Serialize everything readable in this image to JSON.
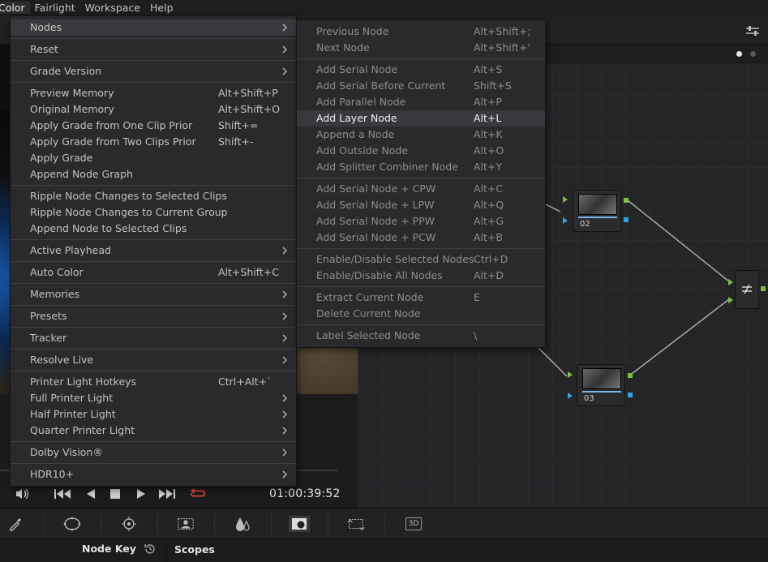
{
  "menubar": {
    "items": [
      "Color",
      "Fairlight",
      "Workspace",
      "Help"
    ],
    "active": "Color"
  },
  "color_menu": {
    "groups": [
      [
        {
          "label": "Nodes",
          "shortcut": "",
          "submenu": true,
          "highlighted": true
        }
      ],
      [
        {
          "label": "Reset",
          "shortcut": "",
          "submenu": true
        }
      ],
      [
        {
          "label": "Grade Version",
          "shortcut": "",
          "submenu": true
        }
      ],
      [
        {
          "label": "Preview Memory",
          "shortcut": "Alt+Shift+P",
          "submenu": false
        },
        {
          "label": "Original Memory",
          "shortcut": "Alt+Shift+O",
          "submenu": false
        },
        {
          "label": "Apply Grade from One Clip Prior",
          "shortcut": "Shift+=",
          "submenu": false
        },
        {
          "label": "Apply Grade from Two Clips Prior",
          "shortcut": "Shift+-",
          "submenu": false
        },
        {
          "label": "Apply Grade",
          "shortcut": "",
          "submenu": false
        },
        {
          "label": "Append Node Graph",
          "shortcut": "",
          "submenu": false
        }
      ],
      [
        {
          "label": "Ripple Node Changes to Selected Clips",
          "shortcut": "",
          "submenu": false
        },
        {
          "label": "Ripple Node Changes to Current Group",
          "shortcut": "",
          "submenu": false
        },
        {
          "label": "Append Node to Selected Clips",
          "shortcut": "",
          "submenu": false
        }
      ],
      [
        {
          "label": "Active Playhead",
          "shortcut": "",
          "submenu": true
        }
      ],
      [
        {
          "label": "Auto Color",
          "shortcut": "Alt+Shift+C",
          "submenu": false
        }
      ],
      [
        {
          "label": "Memories",
          "shortcut": "",
          "submenu": true
        }
      ],
      [
        {
          "label": "Presets",
          "shortcut": "",
          "submenu": true
        }
      ],
      [
        {
          "label": "Tracker",
          "shortcut": "",
          "submenu": true
        }
      ],
      [
        {
          "label": "Resolve Live",
          "shortcut": "",
          "submenu": true
        }
      ],
      [
        {
          "label": "Printer Light Hotkeys",
          "shortcut": "Ctrl+Alt+`",
          "submenu": false
        },
        {
          "label": "Full Printer Light",
          "shortcut": "",
          "submenu": true
        },
        {
          "label": "Half Printer Light",
          "shortcut": "",
          "submenu": true
        },
        {
          "label": "Quarter Printer Light",
          "shortcut": "",
          "submenu": true
        }
      ],
      [
        {
          "label": "Dolby Vision®",
          "shortcut": "",
          "submenu": true
        }
      ],
      [
        {
          "label": "HDR10+",
          "shortcut": "",
          "submenu": true
        }
      ]
    ]
  },
  "nodes_menu": {
    "groups": [
      [
        {
          "label": "Previous Node",
          "shortcut": "Alt+Shift+;",
          "dim": true
        },
        {
          "label": "Next Node",
          "shortcut": "Alt+Shift+'",
          "dim": true
        }
      ],
      [
        {
          "label": "Add Serial Node",
          "shortcut": "Alt+S",
          "dim": true
        },
        {
          "label": "Add Serial Before Current",
          "shortcut": "Shift+S",
          "dim": true
        },
        {
          "label": "Add Parallel Node",
          "shortcut": "Alt+P",
          "dim": true
        },
        {
          "label": "Add Layer Node",
          "shortcut": "Alt+L",
          "dim": false,
          "highlighted": true
        },
        {
          "label": "Append a Node",
          "shortcut": "Alt+K",
          "dim": true
        },
        {
          "label": "Add Outside Node",
          "shortcut": "Alt+O",
          "dim": true
        },
        {
          "label": "Add Splitter Combiner Node",
          "shortcut": "Alt+Y",
          "dim": true
        }
      ],
      [
        {
          "label": "Add Serial Node + CPW",
          "shortcut": "Alt+C",
          "dim": true
        },
        {
          "label": "Add Serial Node + LPW",
          "shortcut": "Alt+Q",
          "dim": true
        },
        {
          "label": "Add Serial Node + PPW",
          "shortcut": "Alt+G",
          "dim": true
        },
        {
          "label": "Add Serial Node + PCW",
          "shortcut": "Alt+B",
          "dim": true
        }
      ],
      [
        {
          "label": "Enable/Disable Selected Nodes",
          "shortcut": "Ctrl+D",
          "dim": true
        },
        {
          "label": "Enable/Disable All Nodes",
          "shortcut": "Alt+D",
          "dim": true
        }
      ],
      [
        {
          "label": "Extract Current Node",
          "shortcut": "E",
          "dim": true
        },
        {
          "label": "Delete Current Node",
          "shortcut": "",
          "dim": true
        }
      ],
      [
        {
          "label": "Label Selected Node",
          "shortcut": "\\",
          "dim": true
        }
      ]
    ]
  },
  "transport": {
    "timecode": "01:00:39:52",
    "buttons": [
      "volume-icon",
      "jump-to-start-icon",
      "play-reverse-icon",
      "stop-icon",
      "play-icon",
      "jump-to-end-icon",
      "loop-icon"
    ]
  },
  "node_graph": {
    "nodes": [
      {
        "label": "02"
      },
      {
        "label": "03"
      }
    ],
    "mixer_icon": "layer-mixer-icon"
  },
  "palette_bar": {
    "icons": [
      "eyedropper-icon",
      "window-circle-icon",
      "tracker-icon",
      "magic-mask-icon",
      "blur-icon",
      "key-icon",
      "sizing-icon",
      "3d-icon"
    ],
    "3d_label": "3D"
  },
  "bottom": {
    "node_key": "Node Key",
    "scopes": "Scopes"
  },
  "colors": {
    "accent_green": "#7ac142",
    "accent_blue": "#2fa3e6",
    "loop_red": "#e5483a",
    "menu_bg": "#2a2a2d",
    "menu_highlight": "#39393d"
  }
}
